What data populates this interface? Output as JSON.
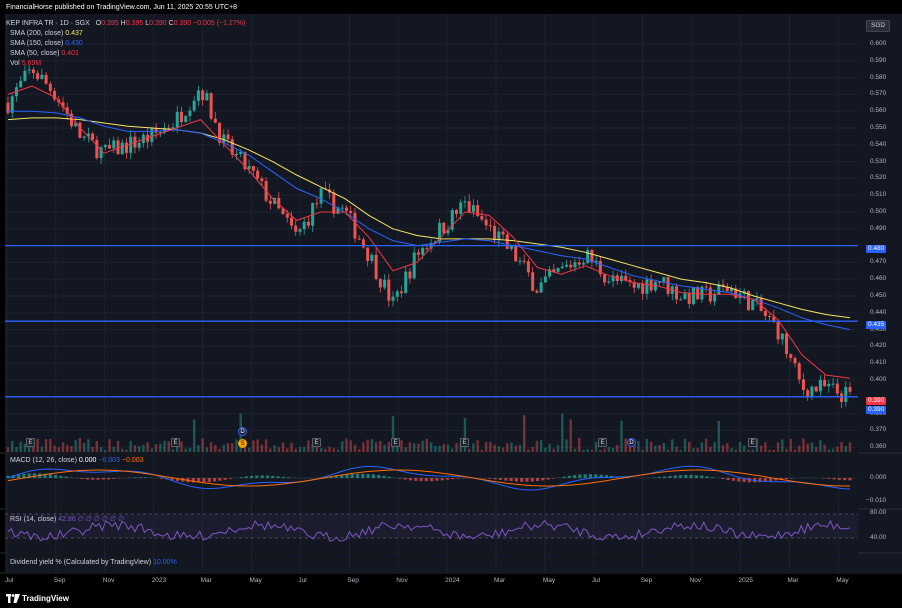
{
  "header": {
    "publisher": "FinancialHorse published on TradingView.com, Jun 11, 2025 20:55 UTC+8"
  },
  "legend": {
    "symbol": "KEP INFRA TR · 1D · SGX",
    "ohlc": {
      "o_label": "O",
      "o": "0.395",
      "h_label": "H",
      "h": "0.395",
      "l_label": "L",
      "l": "0.390",
      "c_label": "C",
      "c": "0.390",
      "change": "−0.005 (−1.27%)"
    },
    "sma200_label": "SMA (200, close)",
    "sma200_value": "0.437",
    "sma150_label": "SMA (150, close)",
    "sma150_value": "0.430",
    "sma50_label": "SMA (50, close)",
    "sma50_value": "0.401",
    "vol_label": "Vol",
    "vol_value": "5.69M"
  },
  "currency_badge": "SGD",
  "macd_legend": {
    "label": "MACD (12, 26, close)",
    "v1": "0.000",
    "v2": "−0.003",
    "v3": "−0.003"
  },
  "rsi_legend": {
    "label": "RSI (14, close)",
    "value": "42.86",
    "placeholders": "∅ ∅ ∅ ∅ ∅ ∅"
  },
  "div_legend": {
    "label": "Dividend yield % (Calculated by TradingView)",
    "value": "10.00%"
  },
  "footer": {
    "logo_text": "TradingView"
  },
  "badges": {
    "b480": "0.480",
    "b435": "0.435",
    "b390a": "0.390",
    "b390b": "0.390"
  },
  "macd_axis": [
    "0.000",
    "−0.010"
  ],
  "rsi_axis": [
    "80.00",
    "40.00"
  ],
  "event_letters": {
    "earnings": "E",
    "dividend": "D",
    "split": "S"
  },
  "colors": {
    "background": "#131722",
    "grid": "#1e222d",
    "up": "#26a69a",
    "down": "#ef5350",
    "sma200": "#f5e663",
    "sma150": "#2962ff",
    "sma50": "#f23645",
    "hline": "#2962ff",
    "macd": "#2962ff",
    "signal": "#ff6d00",
    "rsi": "#7e57c2"
  },
  "chart_data": {
    "type": "line",
    "title": "KEP INFRA TR · 1D · SGX",
    "ylabel": "SGD",
    "ylim": [
      0.36,
      0.605
    ],
    "y_ticks": [
      "0.600",
      "0.590",
      "0.580",
      "0.570",
      "0.560",
      "0.550",
      "0.540",
      "0.530",
      "0.520",
      "0.510",
      "0.500",
      "0.490",
      "0.470",
      "0.460",
      "0.450",
      "0.440",
      "0.430",
      "0.420",
      "0.410",
      "0.400",
      "0.380",
      "0.370",
      "0.360"
    ],
    "x_ticks": [
      "Jul",
      "Sep",
      "Nov",
      "2023",
      "Mar",
      "May",
      "Jul",
      "Sep",
      "Nov",
      "2024",
      "Mar",
      "May",
      "Jul",
      "Sep",
      "Nov",
      "2025",
      "Mar",
      "May"
    ],
    "x": [
      "2022-07",
      "2022-08",
      "2022-09",
      "2022-10",
      "2022-11",
      "2022-12",
      "2023-01",
      "2023-02",
      "2023-03",
      "2023-04",
      "2023-05",
      "2023-06",
      "2023-07",
      "2023-08",
      "2023-09",
      "2023-10",
      "2023-11",
      "2023-12",
      "2024-01",
      "2024-02",
      "2024-03",
      "2024-04",
      "2024-05",
      "2024-06",
      "2024-07",
      "2024-08",
      "2024-09",
      "2024-10",
      "2024-11",
      "2024-12",
      "2025-01",
      "2025-02",
      "2025-03",
      "2025-04",
      "2025-05",
      "2025-06"
    ],
    "series": [
      {
        "name": "KEP INFRA TR",
        "values": [
          0.565,
          0.585,
          0.57,
          0.545,
          0.535,
          0.54,
          0.545,
          0.555,
          0.575,
          0.54,
          0.525,
          0.505,
          0.485,
          0.51,
          0.5,
          0.475,
          0.445,
          0.475,
          0.49,
          0.505,
          0.49,
          0.475,
          0.455,
          0.465,
          0.475,
          0.46,
          0.455,
          0.46,
          0.45,
          0.45,
          0.455,
          0.445,
          0.43,
          0.395,
          0.395,
          0.39
        ]
      },
      {
        "name": "SMA (200, close)",
        "values": [
          0.555,
          0.556,
          0.556,
          0.555,
          0.553,
          0.551,
          0.55,
          0.549,
          0.547,
          0.543,
          0.537,
          0.53,
          0.522,
          0.515,
          0.508,
          0.498,
          0.49,
          0.486,
          0.484,
          0.484,
          0.484,
          0.483,
          0.481,
          0.479,
          0.476,
          0.472,
          0.468,
          0.464,
          0.46,
          0.458,
          0.455,
          0.45,
          0.446,
          0.442,
          0.439,
          0.437
        ]
      },
      {
        "name": "SMA (150, close)",
        "values": [
          0.56,
          0.56,
          0.559,
          0.556,
          0.551,
          0.548,
          0.548,
          0.549,
          0.547,
          0.541,
          0.534,
          0.524,
          0.514,
          0.508,
          0.5,
          0.49,
          0.483,
          0.48,
          0.482,
          0.484,
          0.483,
          0.48,
          0.477,
          0.474,
          0.472,
          0.467,
          0.462,
          0.459,
          0.456,
          0.454,
          0.452,
          0.448,
          0.443,
          0.437,
          0.433,
          0.43
        ]
      },
      {
        "name": "SMA (50, close)",
        "values": [
          0.57,
          0.575,
          0.568,
          0.55,
          0.535,
          0.54,
          0.545,
          0.55,
          0.555,
          0.54,
          0.525,
          0.508,
          0.495,
          0.5,
          0.5,
          0.485,
          0.465,
          0.47,
          0.485,
          0.5,
          0.498,
          0.485,
          0.467,
          0.463,
          0.468,
          0.462,
          0.458,
          0.456,
          0.452,
          0.451,
          0.451,
          0.448,
          0.436,
          0.415,
          0.403,
          0.401
        ]
      }
    ],
    "horizontal_lines": [
      0.48,
      0.435,
      0.39
    ],
    "grid": true,
    "legend_position": "top-left"
  }
}
